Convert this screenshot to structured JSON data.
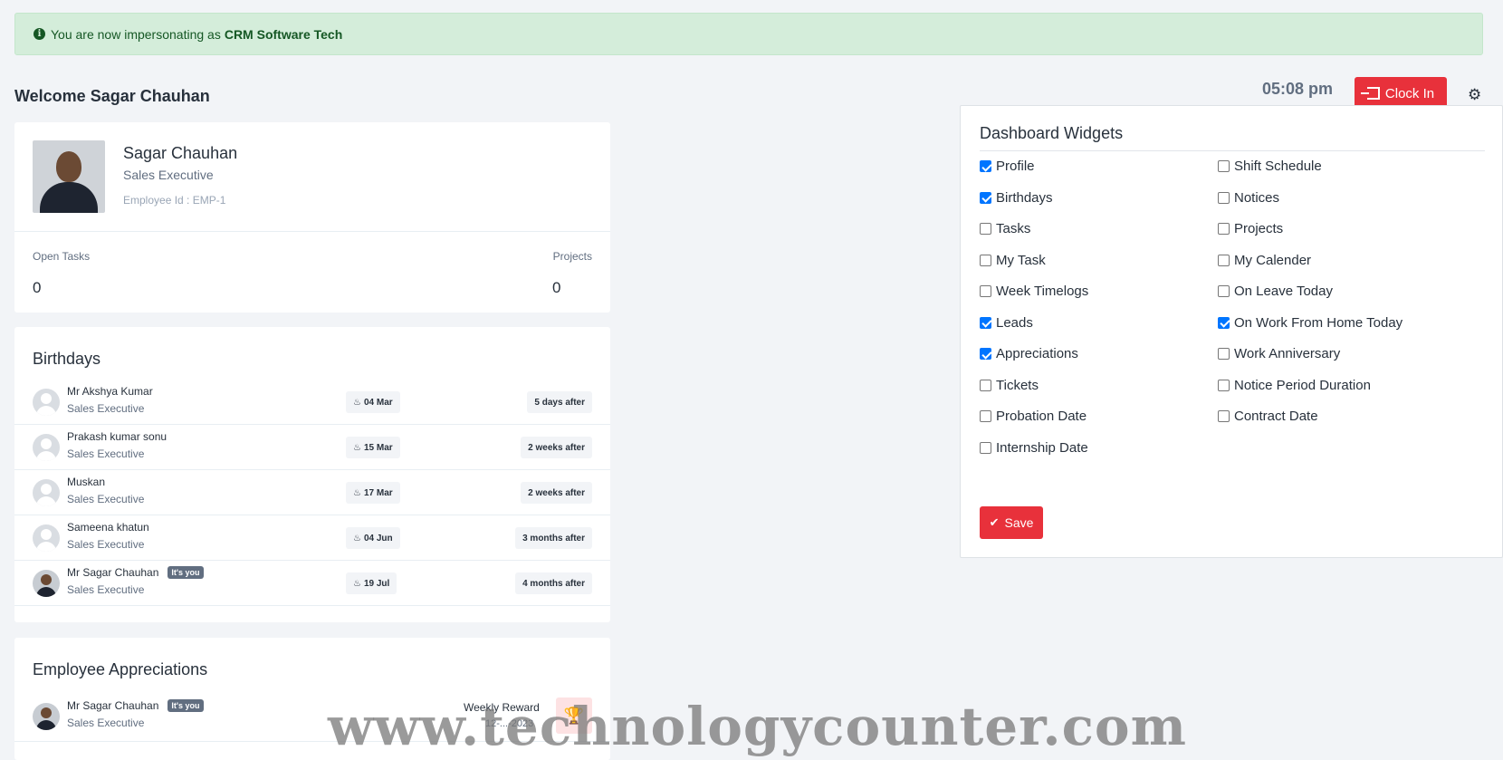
{
  "alert": {
    "prefix": "You are now impersonating as",
    "company": "CRM Software Tech"
  },
  "welcome": "Welcome Sagar Chauhan",
  "clock": {
    "time": "05:08 pm",
    "clock_in_label": "Clock In"
  },
  "profile": {
    "name": "Sagar Chauhan",
    "role": "Sales Executive",
    "employee_id": "Employee Id : EMP-1",
    "open_tasks_label": "Open Tasks",
    "open_tasks_value": "0",
    "projects_label": "Projects",
    "projects_value": "0"
  },
  "birthdays": {
    "title": "Birthdays",
    "items": [
      {
        "name": "Mr Akshya Kumar",
        "role": "Sales Executive",
        "date": "04 Mar",
        "when": "5 days after"
      },
      {
        "name": "Prakash kumar sonu",
        "role": "Sales Executive",
        "date": "15 Mar",
        "when": "2 weeks after"
      },
      {
        "name": "Muskan",
        "role": "Sales Executive",
        "date": "17 Mar",
        "when": "2 weeks after"
      },
      {
        "name": "Sameena khatun",
        "role": "Sales Executive",
        "date": "04 Jun",
        "when": "3 months after"
      },
      {
        "name": "Mr Sagar Chauhan",
        "role": "Sales Executive",
        "date": "19 Jul",
        "when": "4 months after",
        "badge": "It's you"
      }
    ]
  },
  "appreciations": {
    "title": "Employee Appreciations",
    "items": [
      {
        "name": "Mr Sagar Chauhan",
        "badge": "It's you",
        "role": "Sales Executive",
        "award": "Weekly Reward",
        "date": "12-...-2023"
      }
    ]
  },
  "widgets": {
    "title": "Dashboard Widgets",
    "left": [
      {
        "label": "Profile",
        "checked": true
      },
      {
        "label": "Birthdays",
        "checked": true
      },
      {
        "label": "Tasks",
        "checked": false
      },
      {
        "label": "My Task",
        "checked": false
      },
      {
        "label": "Week Timelogs",
        "checked": false
      },
      {
        "label": "Leads",
        "checked": true
      },
      {
        "label": "Appreciations",
        "checked": true
      },
      {
        "label": "Tickets",
        "checked": false
      },
      {
        "label": "Probation Date",
        "checked": false
      },
      {
        "label": "Internship Date",
        "checked": false
      }
    ],
    "right": [
      {
        "label": "Shift Schedule",
        "checked": false
      },
      {
        "label": "Notices",
        "checked": false
      },
      {
        "label": "Projects",
        "checked": false
      },
      {
        "label": "My Calender",
        "checked": false
      },
      {
        "label": "On Leave Today",
        "checked": false
      },
      {
        "label": "On Work From Home Today",
        "checked": true
      },
      {
        "label": "Work Anniversary",
        "checked": false
      },
      {
        "label": "Notice Period Duration",
        "checked": false
      },
      {
        "label": "Contract Date",
        "checked": false
      }
    ],
    "save_label": "Save"
  },
  "watermark": "www.technologycounter.com",
  "colors": {
    "accent": "#e8313b",
    "alert_bg": "#d4edda",
    "checkbox": "#0075ff"
  }
}
